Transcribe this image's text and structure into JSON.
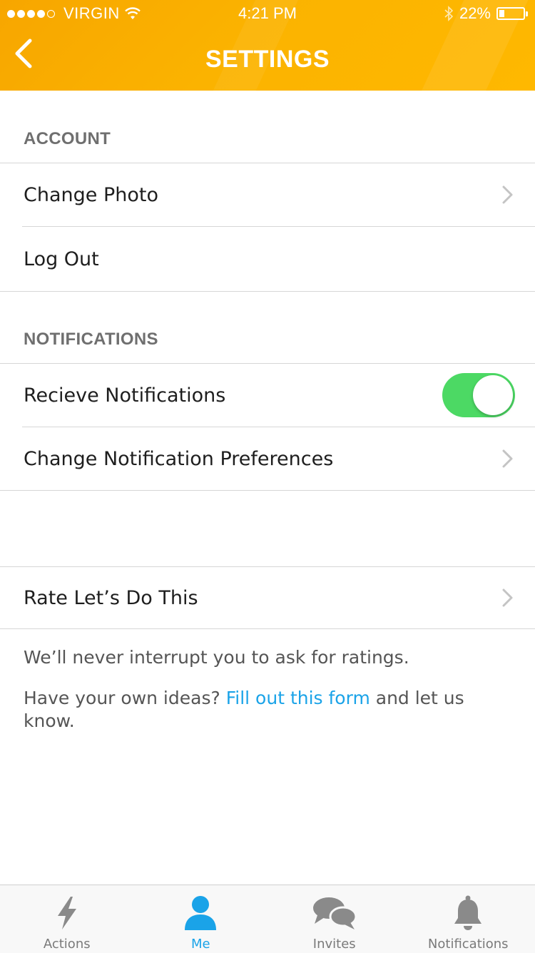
{
  "status_bar": {
    "signal_dots_filled": 4,
    "signal_dots_total": 5,
    "carrier": "VIRGIN",
    "time": "4:21 PM",
    "battery_percent_text": "22%",
    "battery_level": 0.22
  },
  "header": {
    "back_icon": "chevron-left-icon",
    "title": "SETTINGS",
    "color": "#fbb300"
  },
  "sections": {
    "account": {
      "title": "ACCOUNT",
      "change_photo": "Change Photo",
      "log_out": "Log Out"
    },
    "notifications": {
      "title": "NOTIFICATIONS",
      "receive": "Recieve Notifications",
      "receive_enabled": true,
      "preferences": "Change Notification Preferences"
    },
    "rate": {
      "label": "Rate Let’s Do This"
    }
  },
  "info": {
    "line1": "We’ll never interrupt you to ask for ratings.",
    "line2_prefix": "Have your own ideas? ",
    "line2_link": "Fill out this form",
    "line2_suffix": " and let us know."
  },
  "tabbar": {
    "tabs": [
      {
        "label": "Actions",
        "icon": "lightning-icon",
        "active": false
      },
      {
        "label": "Me",
        "icon": "person-icon",
        "active": true
      },
      {
        "label": "Invites",
        "icon": "chat-bubbles-icon",
        "active": false
      },
      {
        "label": "Notifications",
        "icon": "bell-icon",
        "active": false
      }
    ]
  },
  "colors": {
    "accent_blue": "#1aa3e8",
    "toggle_on": "#4cd964",
    "header_orange": "#fbb300"
  }
}
